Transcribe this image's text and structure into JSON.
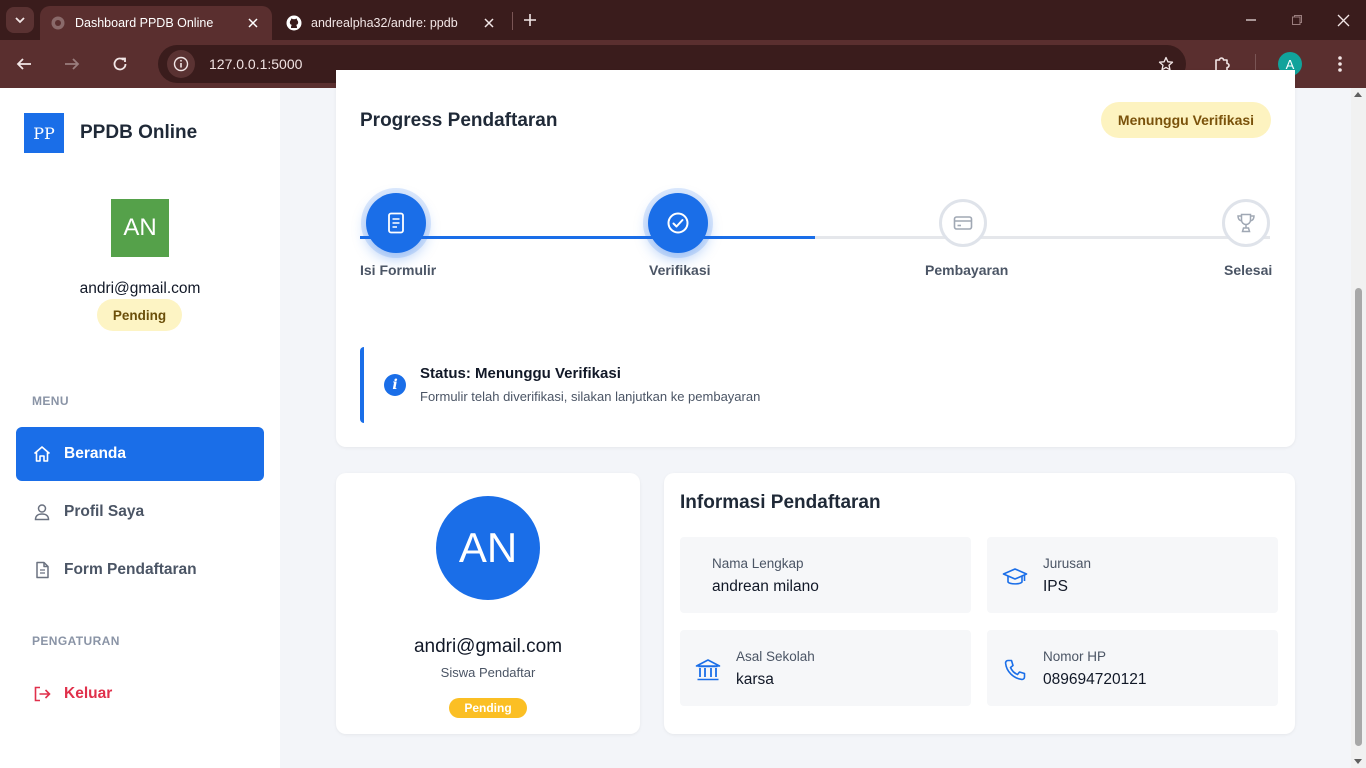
{
  "browser": {
    "tabs": [
      {
        "title": "Dashboard PPDB Online",
        "active": true,
        "favicon": "globe-icon"
      },
      {
        "title": "andrealpha32/andre: ppdb",
        "active": false,
        "favicon": "github-icon"
      }
    ],
    "url": "127.0.0.1:5000",
    "profile_initial": "A"
  },
  "sidebar": {
    "logo": "PP",
    "app_name": "PPDB Online",
    "avatar_initials": "AN",
    "email": "andri@gmail.com",
    "status": "Pending",
    "menu_label": "MENU",
    "settings_label": "PENGATURAN",
    "items": [
      {
        "label": "Beranda",
        "icon": "home-icon",
        "active": true
      },
      {
        "label": "Profil Saya",
        "icon": "user-icon",
        "active": false
      },
      {
        "label": "Form Pendaftaran",
        "icon": "document-icon",
        "active": false
      }
    ],
    "logout": {
      "label": "Keluar",
      "icon": "logout-icon"
    }
  },
  "progress": {
    "title": "Progress Pendaftaran",
    "status_pill": "Menunggu Verifikasi",
    "completed_fraction": 0.5,
    "steps": [
      {
        "label": "Isi Formulir",
        "icon": "form-icon",
        "done": true
      },
      {
        "label": "Verifikasi",
        "icon": "check-circle-icon",
        "done": true
      },
      {
        "label": "Pembayaran",
        "icon": "credit-card-icon",
        "done": false
      },
      {
        "label": "Selesai",
        "icon": "trophy-icon",
        "done": false
      }
    ],
    "alert": {
      "title": "Status: Menunggu Verifikasi",
      "text": "Formulir telah diverifikasi, silakan lanjutkan ke pembayaran"
    }
  },
  "profile_card": {
    "initials": "AN",
    "email": "andri@gmail.com",
    "role": "Siswa Pendaftar",
    "badge": "Pending"
  },
  "info": {
    "title": "Informasi Pendaftaran",
    "fields": [
      {
        "label": "Nama Lengkap",
        "value": "andrean milano",
        "icon": ""
      },
      {
        "label": "Jurusan",
        "value": "IPS",
        "icon": "graduation-cap-icon"
      },
      {
        "label": "Asal Sekolah",
        "value": "karsa",
        "icon": "school-building-icon"
      },
      {
        "label": "Nomor HP",
        "value": "089694720121",
        "icon": "phone-icon"
      }
    ]
  },
  "colors": {
    "primary": "#1a6ee8",
    "warning_bg": "#fdf3c0",
    "warning_badge": "#fbbf24",
    "danger": "#e0304b",
    "avatar_green": "#55a14a"
  }
}
